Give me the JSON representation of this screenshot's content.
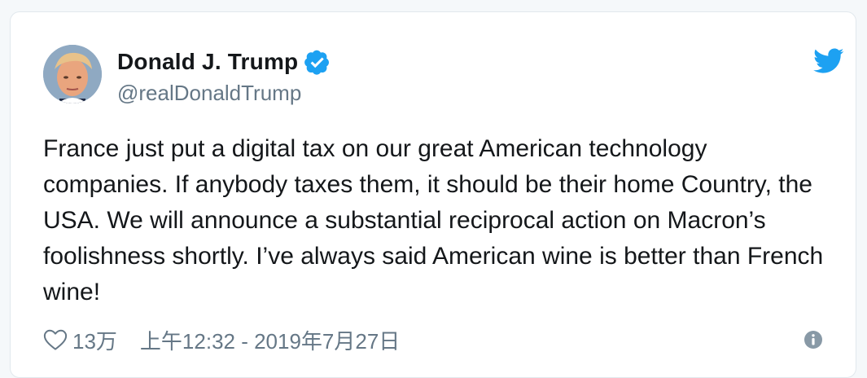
{
  "author": {
    "name": "Donald J. Trump",
    "handle": "@realDonaldTrump"
  },
  "tweet": {
    "text": "France just put a digital tax on our great American technology companies. If anybody taxes them, it should be their home Country, the USA. We will announce a substantial reciprocal action on Macron’s foolishness shortly. I’ve always said American wine is better than French wine!"
  },
  "footer": {
    "likes": "13万",
    "timestamp": "上午12:32 - 2019年7月27日"
  },
  "colors": {
    "twitter_blue": "#1da1f2",
    "text": "#14171a",
    "muted": "#657786"
  },
  "icons": [
    "twitter-bird-icon",
    "verified-badge-icon",
    "heart-icon",
    "info-icon"
  ]
}
